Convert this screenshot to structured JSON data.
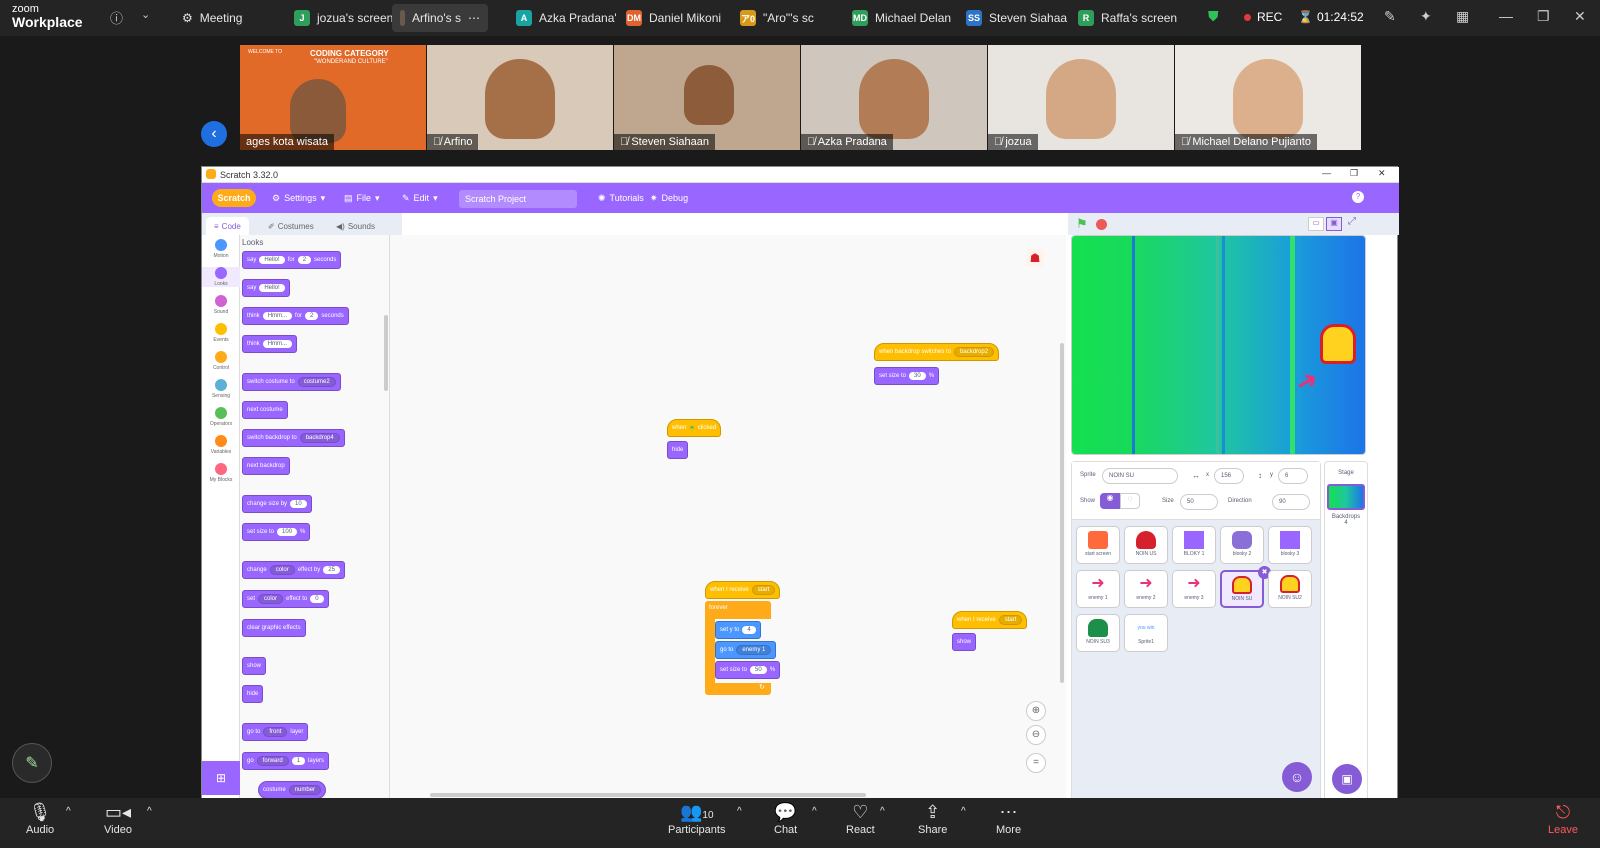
{
  "zoom": {
    "brand_line1": "zoom",
    "brand_line2": "Workplace",
    "tabs": [
      {
        "label": "Meeting",
        "badge": "",
        "color": ""
      },
      {
        "label": "jozua's screen",
        "badge": "J",
        "color": "#2f9e5a"
      },
      {
        "label": "Arfino's s",
        "badge": "",
        "color": ""
      },
      {
        "label": "Azka Pradana'",
        "badge": "A",
        "color": "#1aa3a3"
      },
      {
        "label": "Daniel Mikoni",
        "badge": "DM",
        "color": "#e0632d"
      },
      {
        "label": "\"Aro\"'s sc",
        "badge": "ア0",
        "color": "#d79a18"
      },
      {
        "label": "Michael Delan",
        "badge": "MD",
        "color": "#2f9e5a"
      },
      {
        "label": "Steven Siahaa",
        "badge": "SS",
        "color": "#2d74c9"
      },
      {
        "label": "Raffa's screen",
        "badge": "R",
        "color": "#2f9e5a"
      }
    ],
    "rec_label": "REC",
    "timer": "01:24:52",
    "participants_count": "10",
    "toolbar": {
      "audio": "Audio",
      "video": "Video",
      "participants": "Participants",
      "chat": "Chat",
      "react": "React",
      "share": "Share",
      "more": "More",
      "leave": "Leave"
    },
    "videos": [
      {
        "name": "ages kota wisata",
        "bg": "#e26a28"
      },
      {
        "name": "Arfino",
        "bg": "#d8c9b8"
      },
      {
        "name": "Steven Siahaan",
        "bg": "#bfa78f"
      },
      {
        "name": "Azka Pradana",
        "bg": "#cfc7bd"
      },
      {
        "name": "jozua",
        "bg": "#e8e4e0"
      },
      {
        "name": "Michael Delano Pujianto",
        "bg": "#ece9e4"
      }
    ],
    "video_banner_title": "CODING CATEGORY",
    "video_banner_sub": "\"WONDERAND CULTURE\"",
    "video_welcome": "WELCOME TO"
  },
  "scratch": {
    "window_title": "Scratch 3.32.0",
    "logo": "Scratch",
    "menu": {
      "settings": "Settings",
      "file": "File",
      "edit": "Edit",
      "project_title": "Scratch Project",
      "tutorials": "Tutorials",
      "debug": "Debug"
    },
    "editor_tabs": {
      "code": "Code",
      "costumes": "Costumes",
      "sounds": "Sounds"
    },
    "categories": [
      {
        "label": "Motion",
        "color": "#4c97ff"
      },
      {
        "label": "Looks",
        "color": "#9966ff"
      },
      {
        "label": "Sound",
        "color": "#cf63cf"
      },
      {
        "label": "Events",
        "color": "#ffbf00"
      },
      {
        "label": "Control",
        "color": "#ffab19"
      },
      {
        "label": "Sensing",
        "color": "#5cb1d6"
      },
      {
        "label": "Operators",
        "color": "#59c059"
      },
      {
        "label": "Variables",
        "color": "#ff8c1a"
      },
      {
        "label": "My Blocks",
        "color": "#ff6680"
      }
    ],
    "palette": {
      "heading": "Looks",
      "say_for": {
        "a": "say",
        "v1": "Hello!",
        "b": "for",
        "v2": "2",
        "c": "seconds"
      },
      "say": {
        "a": "say",
        "v1": "Hello!"
      },
      "think_for": {
        "a": "think",
        "v1": "Hmm...",
        "b": "for",
        "v2": "2",
        "c": "seconds"
      },
      "think": {
        "a": "think",
        "v1": "Hmm..."
      },
      "switch_costume": {
        "a": "switch costume to",
        "v1": "costume2"
      },
      "next_costume": "next costume",
      "switch_backdrop": {
        "a": "switch backdrop to",
        "v1": "backdrop4"
      },
      "next_backdrop": "next backdrop",
      "change_size": {
        "a": "change size by",
        "v1": "10"
      },
      "set_size": {
        "a": "set size to",
        "v1": "100",
        "b": "%"
      },
      "change_effect": {
        "a": "change",
        "v1": "color",
        "b": "effect by",
        "v2": "25"
      },
      "set_effect": {
        "a": "set",
        "v1": "color",
        "b": "effect to",
        "v2": "0"
      },
      "clear_effects": "clear graphic effects",
      "show": "show",
      "hide": "hide",
      "go_to_layer": {
        "a": "go to",
        "v1": "front",
        "b": "layer"
      },
      "go_layers": {
        "a": "go",
        "v1": "forward",
        "v2": "1",
        "b": "layers"
      },
      "costume": {
        "a": "costume",
        "v1": "number"
      }
    },
    "scripts": {
      "backdrop_hat": {
        "a": "when backdrop switches to",
        "v1": "backdrop2"
      },
      "backdrop_size": {
        "a": "set size to",
        "v1": "30",
        "b": "%"
      },
      "flag_hat": {
        "a": "when",
        "b": "clicked"
      },
      "flag_hide": "hide",
      "receive_hat": {
        "a": "when I receive",
        "v1": "start"
      },
      "forever": "forever",
      "set_y": {
        "a": "set y to",
        "v1": "4"
      },
      "go_to": {
        "a": "go to",
        "v1": "enemy 1"
      },
      "set_size2": {
        "a": "set size to",
        "v1": "50",
        "b": "%"
      },
      "receive_hat2": {
        "a": "when I receive",
        "v1": "start"
      },
      "show2": "show"
    },
    "sprite_info": {
      "sprite_label": "Sprite",
      "sprite_name": "NOIN SU",
      "x_label": "x",
      "x": "156",
      "y_label": "y",
      "y": "6",
      "show_label": "Show",
      "size_label": "Size",
      "size": "50",
      "direction_label": "Direction",
      "direction": "90"
    },
    "sprites": [
      {
        "name": "start screen",
        "color": "#ff6a3d"
      },
      {
        "name": "NOIN US",
        "color": "#d6212c"
      },
      {
        "name": "BLOKY 1",
        "color": "#9966ff"
      },
      {
        "name": "blooky 2",
        "color": "#8a6fd6"
      },
      {
        "name": "blooky 3",
        "color": "#9966ff"
      },
      {
        "name": "enemy 1",
        "color": "#e8327a"
      },
      {
        "name": "enemy 2",
        "color": "#e8327a"
      },
      {
        "name": "enemy 3",
        "color": "#e8327a"
      },
      {
        "name": "NOIN SU",
        "color": "#d6212c"
      },
      {
        "name": "NOIN SU2",
        "color": "#d6212c"
      },
      {
        "name": "NOIN SU3",
        "color": "#1c8f4a"
      },
      {
        "name": "Sprite1",
        "color": "#4c97ff"
      }
    ],
    "sprite1_text": "you win",
    "stage_panel": {
      "title": "Stage",
      "backdrops_label": "Backdrops",
      "backdrops_count": "4"
    }
  }
}
